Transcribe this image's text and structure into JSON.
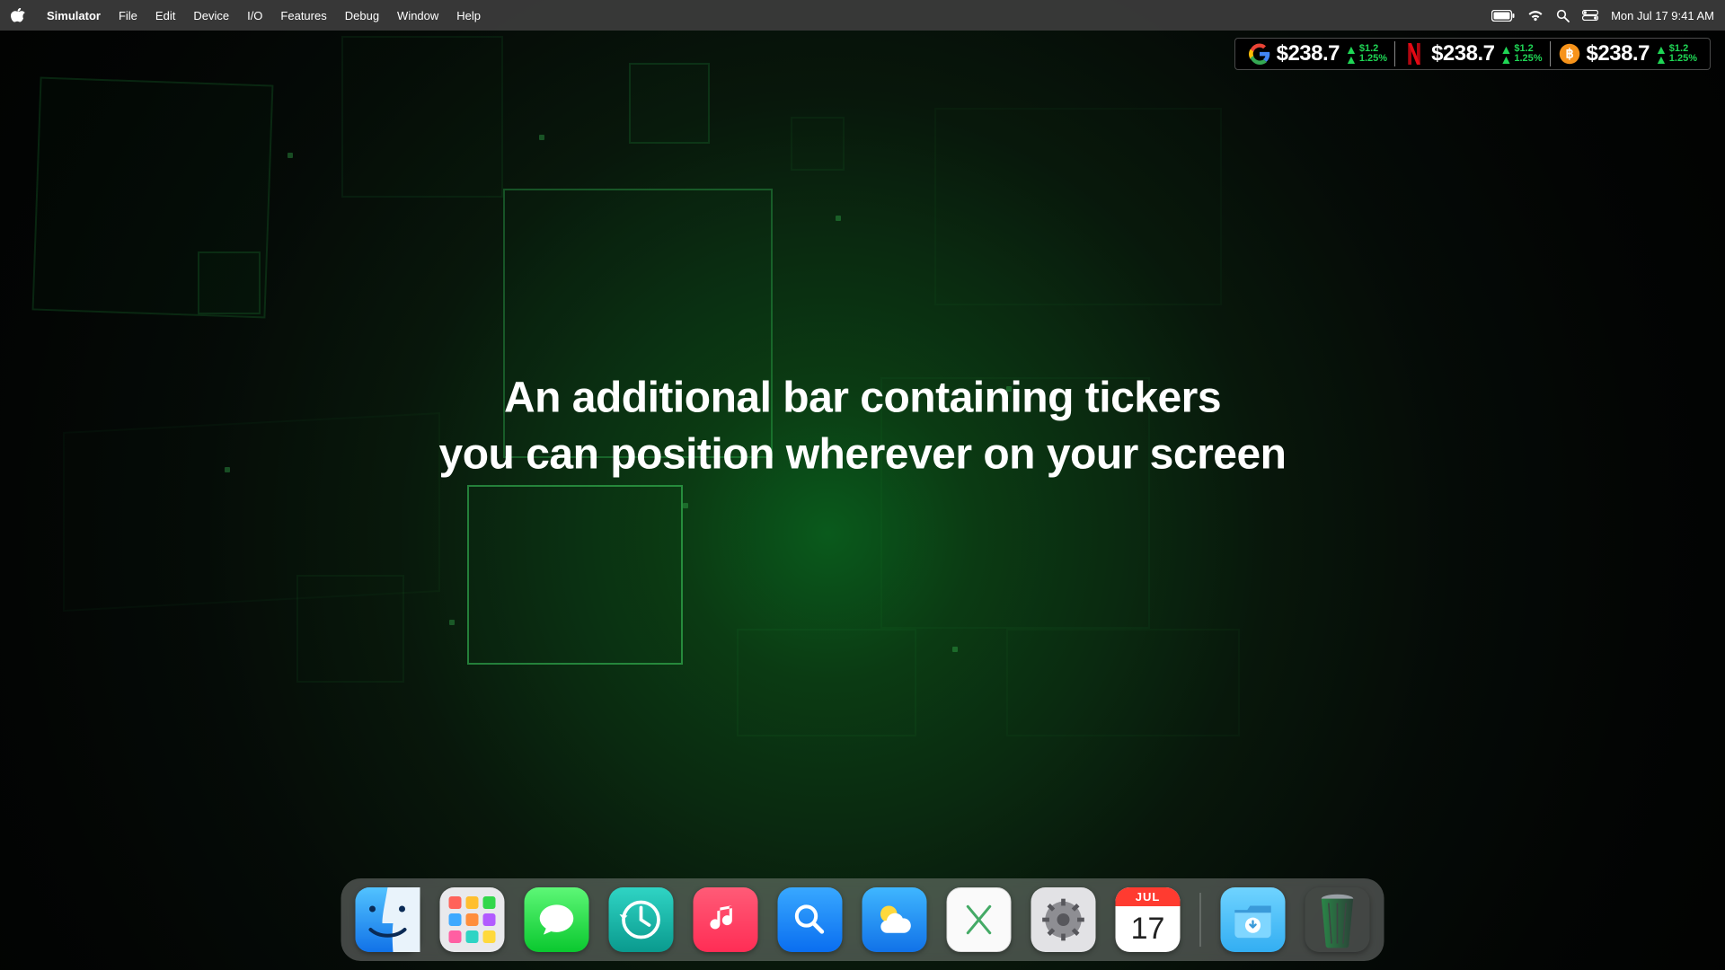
{
  "menubar": {
    "app": "Simulator",
    "items": [
      "File",
      "Edit",
      "Device",
      "I/O",
      "Features",
      "Debug",
      "Window",
      "Help"
    ],
    "datetime": "Mon Jul 17  9:41 AM"
  },
  "tickers": [
    {
      "logo": "google",
      "price": "$238.7",
      "change_abs": "$1.2",
      "change_pct": "1.25%"
    },
    {
      "logo": "netflix",
      "price": "$238.7",
      "change_abs": "$1.2",
      "change_pct": "1.25%"
    },
    {
      "logo": "bitcoin",
      "price": "$238.7",
      "change_abs": "$1.2",
      "change_pct": "1.25%"
    }
  ],
  "hero": {
    "line1": "An additional bar containing tickers",
    "line2": "you can position wherever on your screen"
  },
  "calendar": {
    "month": "JUL",
    "day": "17"
  },
  "launchpad_colors": [
    "#ff6259",
    "#ffbf2f",
    "#32d74b",
    "#3da9ff",
    "#ff8e3c",
    "#b25bff",
    "#ff5fa2",
    "#2fd4c4",
    "#ffd93c"
  ],
  "trend_direction": "up"
}
